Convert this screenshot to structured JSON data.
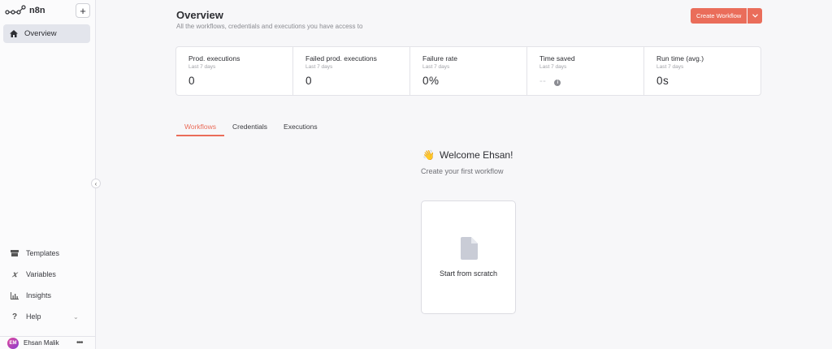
{
  "app": {
    "logo_text": "n8n"
  },
  "sidebar": {
    "add_label": "+",
    "overview_label": "Overview",
    "bottom_items": [
      {
        "label": "Templates",
        "icon": "box-icon"
      },
      {
        "label": "Variables",
        "icon": "variable-icon"
      },
      {
        "label": "Insights",
        "icon": "chart-icon"
      },
      {
        "label": "Help",
        "icon": "question-icon"
      }
    ],
    "user": {
      "initials": "EM",
      "name": "Ehsan Malik",
      "more": "•••"
    }
  },
  "header": {
    "title": "Overview",
    "subtitle": "All the workflows, credentials and executions you have access to",
    "create_label": "Create Workflow",
    "create_dropdown": "⌄"
  },
  "stats": [
    {
      "label": "Prod. executions",
      "sub": "Last 7 days",
      "value": "0"
    },
    {
      "label": "Failed prod. executions",
      "sub": "Last 7 days",
      "value": "0"
    },
    {
      "label": "Failure rate",
      "sub": "Last 7 days",
      "value": "0%"
    },
    {
      "label": "Time saved",
      "sub": "Last 7 days",
      "value": "--",
      "info": "i"
    },
    {
      "label": "Run time (avg.)",
      "sub": "Last 7 days",
      "value": "0s"
    }
  ],
  "tabs": [
    "Workflows",
    "Credentials",
    "Executions"
  ],
  "active_tab": "Workflows",
  "empty_state": {
    "emoji": "👋",
    "welcome": "Welcome Ehsan!",
    "subtitle": "Create your first workflow",
    "card_label": "Start from scratch"
  },
  "colors": {
    "accent": "#ea6d5a",
    "sidebar_active": "#e3e5ec",
    "background": "#f7f7f9"
  }
}
